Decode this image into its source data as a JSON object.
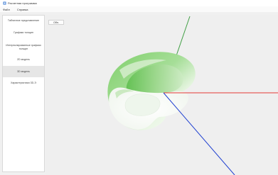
{
  "window": {
    "title": "Расчетная программа"
  },
  "menu": {
    "items": [
      "Файл",
      "Справка"
    ]
  },
  "sidebar": {
    "items": [
      {
        "label": "Табличное представление"
      },
      {
        "label": "Графики толщин"
      },
      {
        "label": "Интерполированные графики толщин"
      },
      {
        "label": "2D модель"
      },
      {
        "label": "3D модель"
      },
      {
        "label": "Характеристики 3D-Э"
      }
    ]
  },
  "viewport": {
    "view_button": "Обн."
  },
  "colors": {
    "x_axis": "#e53935",
    "y_axis": "#43a047",
    "z_axis": "#1e3fd0",
    "model_green": "#7fcf6a"
  }
}
